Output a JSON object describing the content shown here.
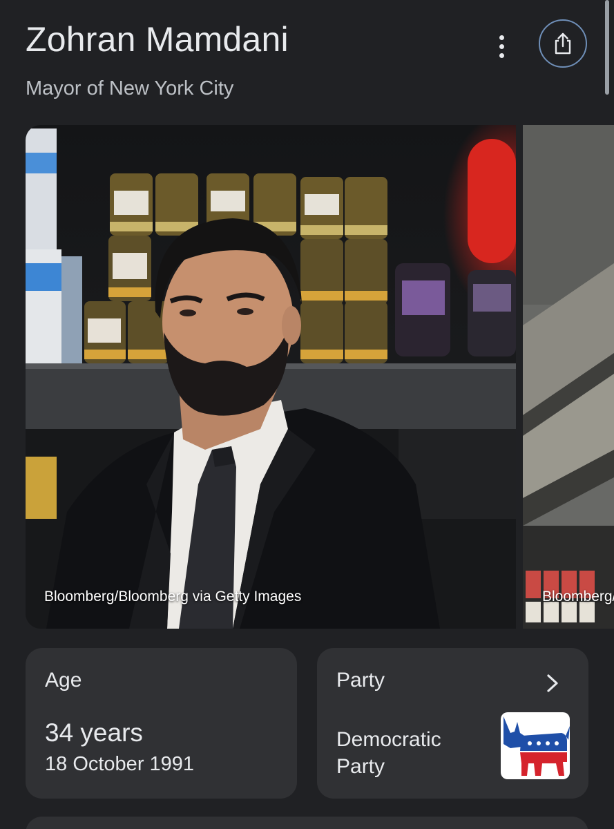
{
  "header": {
    "title": "Zohran Mamdani",
    "subtitle": "Mayor of New York City"
  },
  "icons": {
    "more": "more-vertical-icon",
    "share": "share-icon",
    "chevron": "chevron-right-icon"
  },
  "images": [
    {
      "credit": "Bloomberg/Bloomberg via Getty Images"
    },
    {
      "credit": "Bloomberg/Bloomberg via Getty Images"
    }
  ],
  "cards": {
    "age": {
      "label": "Age",
      "value": "34 years",
      "date": "18 October 1991"
    },
    "party": {
      "label": "Party",
      "value": "Democratic Party"
    }
  },
  "colors": {
    "background": "#202124",
    "card": "#303134",
    "text": "#e8eaed",
    "subtle_text": "#bdc1c6",
    "share_ring": "#6f8fb8",
    "democratic_blue": "#1f4fa8",
    "democratic_red": "#d5232c"
  }
}
